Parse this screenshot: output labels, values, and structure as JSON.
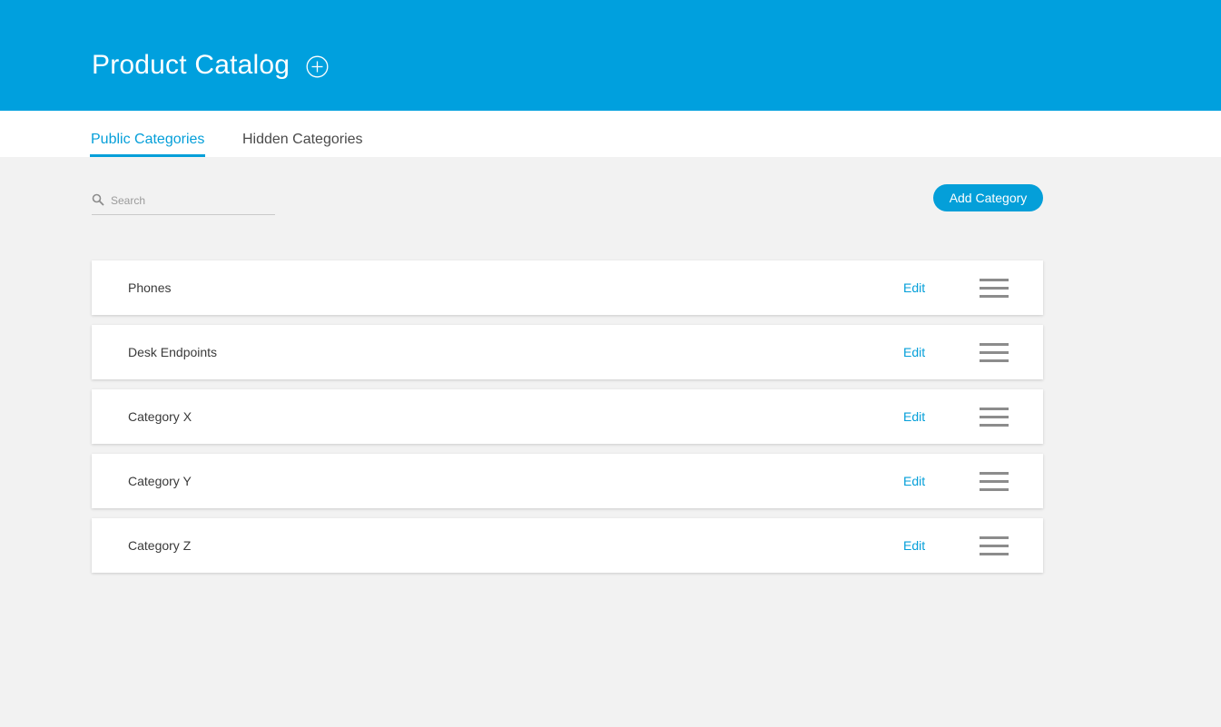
{
  "header": {
    "title": "Product Catalog",
    "add_icon": "plus-circle-icon"
  },
  "tabs": [
    {
      "label": "Public Categories",
      "active": true
    },
    {
      "label": "Hidden Categories",
      "active": false
    }
  ],
  "search": {
    "placeholder": "Search",
    "value": "",
    "icon": "search-icon"
  },
  "add_button": {
    "label": "Add Category"
  },
  "categories": [
    {
      "name": "Phones",
      "edit_label": "Edit",
      "handle_icon": "drag-handle-icon"
    },
    {
      "name": "Desk Endpoints",
      "edit_label": "Edit",
      "handle_icon": "drag-handle-icon"
    },
    {
      "name": "Category X",
      "edit_label": "Edit",
      "handle_icon": "drag-handle-icon"
    },
    {
      "name": "Category Y",
      "edit_label": "Edit",
      "handle_icon": "drag-handle-icon"
    },
    {
      "name": "Category Z",
      "edit_label": "Edit",
      "handle_icon": "drag-handle-icon"
    }
  ],
  "colors": {
    "header_bg": "#00a0de",
    "accent": "#049fd9",
    "page_bg": "#f2f2f2",
    "handle": "#8c8c8c"
  }
}
